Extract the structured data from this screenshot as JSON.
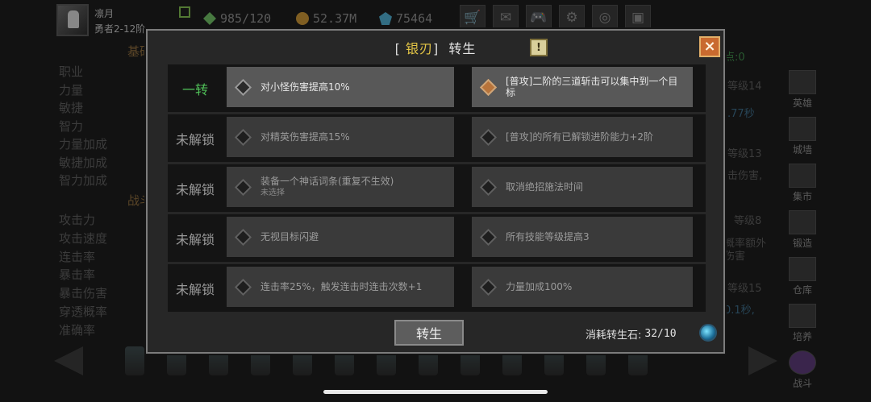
{
  "hero": {
    "name": "凛月",
    "rank": "勇者2-12阶"
  },
  "resources": {
    "energy": "985/120",
    "gold": "52.37M",
    "gems": "75464"
  },
  "top_icons": [
    "cart-icon",
    "mail-icon",
    "gamepad-icon",
    "gear-icon",
    "wheel-icon",
    "chest-icon"
  ],
  "left_panel": {
    "title1": "基础",
    "stats1": [
      "职业",
      "力量",
      "敏捷",
      "智力",
      "力量加成",
      "敏捷加成",
      "智力加成"
    ],
    "title2": "战斗",
    "stats2": [
      "攻击力",
      "攻击速度",
      "连击率",
      "暴击率",
      "暴击伤害",
      "穿透概率",
      "准确率"
    ]
  },
  "right_frags": {
    "points": "点:0",
    "lv14": "等级14",
    "sec77": ".77秒",
    "lv13": "等级13",
    "dmg": "击伤害,",
    "lv8": "等级8",
    "extra": "概率额外",
    "extra2": "伤害",
    "lv15": "等级15",
    "sec1": "0.1秒,"
  },
  "side_nav": [
    "英雄",
    "城墙",
    "集市",
    "锻造",
    "仓库",
    "培养",
    "战斗"
  ],
  "modal": {
    "title_open": "[",
    "title_highlight": "银刃",
    "title_close": "]",
    "title_text": "转生",
    "info": "!",
    "close": "×",
    "rows": [
      {
        "label": "一转",
        "unlocked": true,
        "left": {
          "text": "对小怪伤害提高10%",
          "sub": ""
        },
        "right": {
          "text": "[普攻]二阶的三道斩击可以集中到一个目标",
          "sub": ""
        },
        "selected": "right"
      },
      {
        "label": "未解锁",
        "unlocked": false,
        "left": {
          "text": "对精英伤害提高15%",
          "sub": ""
        },
        "right": {
          "text": "[普攻]的所有已解锁进阶能力+2阶",
          "sub": ""
        }
      },
      {
        "label": "未解锁",
        "unlocked": false,
        "left": {
          "text": "装备一个神话词条(重复不生效)",
          "sub": "未选择"
        },
        "right": {
          "text": "取消绝招施法时间",
          "sub": ""
        }
      },
      {
        "label": "未解锁",
        "unlocked": false,
        "left": {
          "text": "无视目标闪避",
          "sub": ""
        },
        "right": {
          "text": "所有技能等级提高3",
          "sub": ""
        }
      },
      {
        "label": "未解锁",
        "unlocked": false,
        "left": {
          "text": "连击率25%，触发连击时连击次数+1",
          "sub": ""
        },
        "right": {
          "text": "力量加成100%",
          "sub": ""
        }
      }
    ],
    "rebirth_button": "转生",
    "cost_label": "消耗转生石:",
    "cost_value": "32/10"
  },
  "colors": {
    "accent_gold": "#e4c646",
    "unlocked_green": "#4fbf57",
    "close_orange": "#c96a2f",
    "selected_diamond": "#b8743b"
  }
}
